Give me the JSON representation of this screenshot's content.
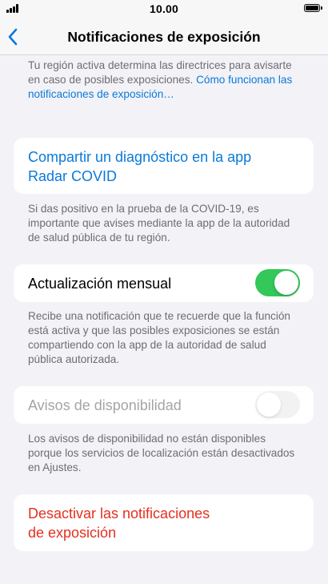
{
  "status_bar": {
    "time": "10.00"
  },
  "nav": {
    "title": "Notificaciones de exposición"
  },
  "intro": {
    "text": "Tu región activa determina las directrices para avisarte en caso de posibles exposiciones. ",
    "link": "Cómo funcionan las notificaciones de exposición…"
  },
  "share_diagnosis": {
    "label": "Compartir un diagnóstico en la app Radar COVID",
    "footer": "Si das positivo en la prueba de la COVID-19, es importante que avises mediante la app de la autoridad de salud pública de tu región."
  },
  "monthly_update": {
    "label": "Actualización mensual",
    "enabled": true,
    "footer": "Recibe una notificación que te recuerde que la función está activa y que las posibles exposiciones se están compartiendo con la app de la autoridad de salud pública autorizada."
  },
  "availability": {
    "label": "Avisos de disponibilidad",
    "enabled": false,
    "footer": "Los avisos de disponibilidad no están disponibles porque los servicios de localización están desactivados en Ajustes."
  },
  "deactivate": {
    "label": "Desactivar las notificaciones de exposición"
  },
  "colors": {
    "link_blue": "#0a7ad9",
    "destructive_red": "#e5301f",
    "toggle_green": "#34c759",
    "disabled_gray": "#a5a5a9"
  }
}
